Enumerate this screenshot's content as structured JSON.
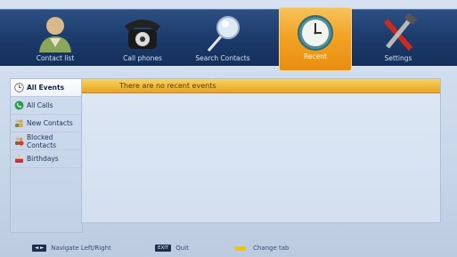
{
  "tabs": [
    {
      "label": "Contact list",
      "icon": "contact-person-icon"
    },
    {
      "label": "Call phones",
      "icon": "rotary-phone-icon"
    },
    {
      "label": "Search Contacts",
      "icon": "magnifier-icon"
    },
    {
      "label": "Recent",
      "icon": "clock-icon",
      "active": true
    },
    {
      "label": "Settings",
      "icon": "tools-icon"
    }
  ],
  "sidebar": {
    "items": [
      {
        "label": "All Events",
        "icon": "clock-icon",
        "selected": true
      },
      {
        "label": "All Calls",
        "icon": "phone-icon"
      },
      {
        "label": "New Contacts",
        "icon": "new-contacts-icon"
      },
      {
        "label": "Blocked Contacts",
        "icon": "blocked-contacts-icon"
      },
      {
        "label": "Birthdays",
        "icon": "cake-icon"
      }
    ]
  },
  "main": {
    "message": "There are no recent events"
  },
  "footer": {
    "navigate": {
      "key": "◄ ►",
      "label": "Navigate Left/Right"
    },
    "quit": {
      "key": "EXIT",
      "label": "Quit"
    },
    "change_tab": {
      "label": "Change tab"
    }
  },
  "colors": {
    "accent": "#f2a324",
    "topbar": "#1c3a6a",
    "header": "#efb73a"
  }
}
